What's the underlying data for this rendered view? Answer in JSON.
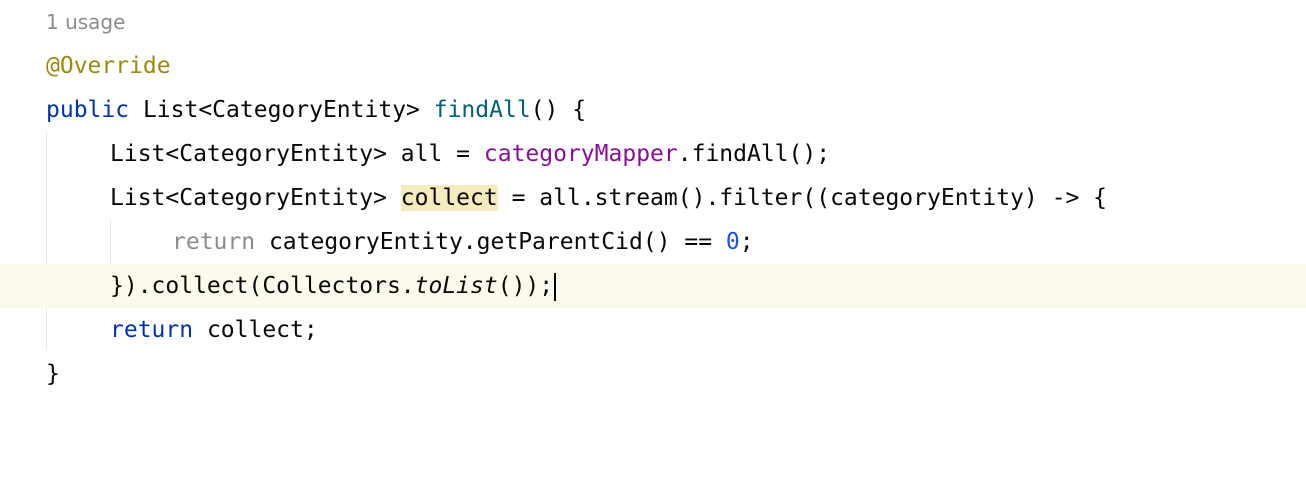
{
  "editor": {
    "usage_hint": "1 usage",
    "lines": {
      "l1": {
        "annotation": "@Override"
      },
      "l2": {
        "kw": "public",
        "type": " List<CategoryEntity> ",
        "method": "findAll",
        "rest": "() {"
      },
      "l3": {
        "type": "List<CategoryEntity> all = ",
        "field": "categoryMapper",
        "rest": ".findAll();"
      },
      "l4": {
        "type": "List<CategoryEntity> ",
        "var": "collect",
        "rest": " = all.stream().filter((categoryEntity) -> {"
      },
      "l5": {
        "kw": "return",
        "rest": " categoryEntity.getParentCid() == ",
        "num": "0",
        "end": ";"
      },
      "l6": {
        "pre": "}).collect(Collectors.",
        "italic": "toList",
        "end": "());"
      },
      "l7": {
        "kw": "return",
        "rest": " collect;"
      },
      "l8": {
        "brace": "}"
      }
    }
  }
}
